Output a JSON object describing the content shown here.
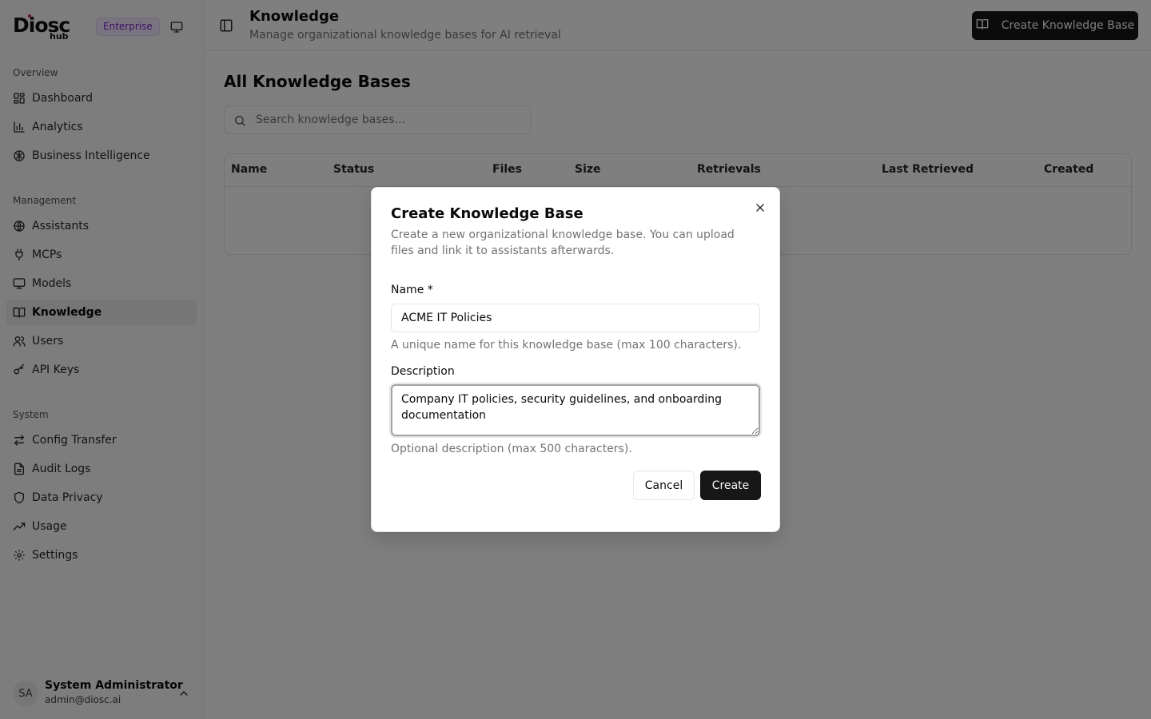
{
  "app": {
    "brand": "Diosc",
    "brand_sub": "hub",
    "edition_badge": "Enterprise"
  },
  "sidebar": {
    "sections": [
      {
        "label": "Overview",
        "items": [
          {
            "label": "Dashboard",
            "icon": "dashboard-icon"
          },
          {
            "label": "Analytics",
            "icon": "bar-chart-icon"
          },
          {
            "label": "Business Intelligence",
            "icon": "brain-icon"
          }
        ]
      },
      {
        "label": "Management",
        "items": [
          {
            "label": "Assistants",
            "icon": "globe-icon"
          },
          {
            "label": "MCPs",
            "icon": "plug-icon"
          },
          {
            "label": "Models",
            "icon": "monitor-icon"
          },
          {
            "label": "Knowledge",
            "icon": "book-icon",
            "active": true
          },
          {
            "label": "Users",
            "icon": "users-icon"
          },
          {
            "label": "API Keys",
            "icon": "key-icon"
          }
        ]
      },
      {
        "label": "System",
        "items": [
          {
            "label": "Config Transfer",
            "icon": "transfer-icon"
          },
          {
            "label": "Audit Logs",
            "icon": "file-text-icon"
          },
          {
            "label": "Data Privacy",
            "icon": "shield-icon"
          },
          {
            "label": "Usage",
            "icon": "trending-up-icon"
          },
          {
            "label": "Settings",
            "icon": "gear-icon"
          }
        ]
      }
    ],
    "user": {
      "initials": "SA",
      "name": "System Administrator",
      "email": "admin@diosc.ai"
    }
  },
  "header": {
    "title": "Knowledge",
    "subtitle": "Manage organizational knowledge bases for AI retrieval",
    "create_button": "Create Knowledge Base"
  },
  "main": {
    "section_title": "All Knowledge Bases",
    "search_placeholder": "Search knowledge bases...",
    "table": {
      "columns": [
        "Name",
        "Status",
        "Files",
        "Size",
        "Retrievals",
        "Last Retrieved",
        "Created"
      ]
    }
  },
  "dialog": {
    "title": "Create Knowledge Base",
    "description": "Create a new organizational knowledge base. You can upload files and link it to assistants afterwards.",
    "name_label": "Name *",
    "name_value": "ACME IT Policies",
    "name_hint": "A unique name for this knowledge base (max 100 characters).",
    "description_label": "Description",
    "description_value": "Company IT policies, security guidelines, and onboarding documentation",
    "description_hint": "Optional description (max 500 characters).",
    "cancel_label": "Cancel",
    "create_label": "Create"
  },
  "colors": {
    "primary": "#171717",
    "badge_text": "#7e22ce",
    "badge_bg": "#f3e8ff",
    "overlay": "rgba(0,0,0,0.5)"
  }
}
